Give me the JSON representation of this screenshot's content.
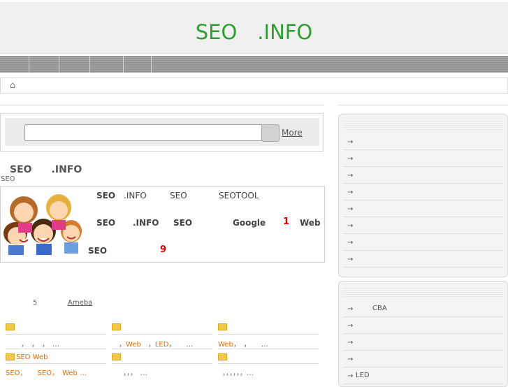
{
  "header": {
    "title": "SEO　.INFO"
  },
  "search": {
    "placeholder": "",
    "more_label": "More"
  },
  "intro": {
    "title": "SEO　　.INFO",
    "subtitle": "SEO",
    "line1": [
      "SEO",
      ".INFO",
      "SEO",
      "SEOTOOL"
    ],
    "line2": [
      "SEO",
      ".INFO",
      "SEO",
      "Google",
      "1",
      "Web"
    ],
    "line3": [
      "SEO",
      "9"
    ]
  },
  "news": {
    "count": "5",
    "ameba": "Ameba",
    "cols": [
      {
        "line": "，　，　，　…"
      },
      {
        "prefix": "，",
        "web": "Web",
        "mid": "，",
        "led": "LED",
        "rest": "，　　…"
      },
      {
        "web": "Web",
        "rest": "，　，　　…"
      }
    ],
    "row2": [
      {
        "title": "SEO Web",
        "parts": [
          "SEO",
          "，",
          "SEO",
          "，",
          "Web",
          "…"
        ]
      },
      {
        "line": "，，，　…"
      },
      {
        "line": "，，，，，，…"
      }
    ]
  },
  "sidebar": {
    "box1": {
      "items": [
        "→",
        "→",
        "→",
        "→",
        "→",
        "→",
        "→",
        "→"
      ]
    },
    "box2": {
      "items": [
        {
          "arrow": "→",
          "label": "CBA"
        },
        {
          "arrow": "→",
          "label": ""
        },
        {
          "arrow": "→",
          "label": ""
        },
        {
          "arrow": "→",
          "label": ""
        },
        {
          "arrow": "→",
          "label": "LED"
        }
      ]
    }
  },
  "icons": {
    "home": "home-icon",
    "folder": "folder-icon"
  },
  "colors": {
    "title": "#2f9e2f",
    "highlight": "#e00000",
    "link_orange": "#e07000"
  }
}
